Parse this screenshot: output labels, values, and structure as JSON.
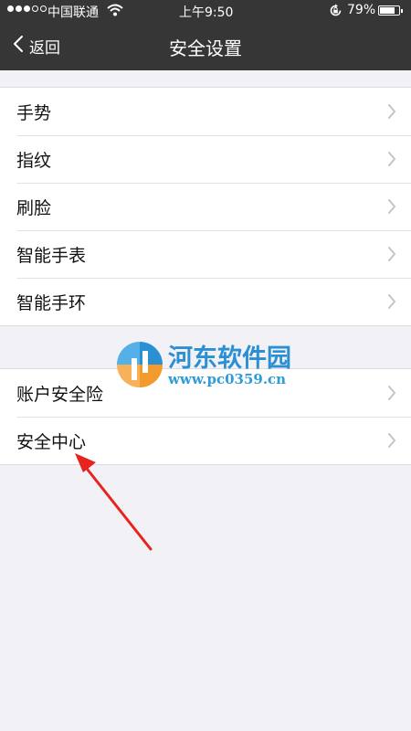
{
  "status_bar": {
    "carrier": "中国联通",
    "time": "上午9:50",
    "battery_percent": "79%",
    "battery_level": 0.79,
    "icons": [
      "signal-dots-icon",
      "wifi-icon",
      "rotation-lock-icon",
      "battery-icon"
    ]
  },
  "nav": {
    "back_label": "返回",
    "title": "安全设置"
  },
  "groups": [
    {
      "items": [
        {
          "label": "手势"
        },
        {
          "label": "指纹"
        },
        {
          "label": "刷脸"
        },
        {
          "label": "智能手表"
        },
        {
          "label": "智能手环"
        }
      ]
    },
    {
      "items": [
        {
          "label": "账户安全险"
        },
        {
          "label": "安全中心"
        }
      ]
    }
  ],
  "watermark": {
    "name": "河东软件园",
    "url": "www.pc0359.cn"
  },
  "colors": {
    "nav_background": "#363636",
    "page_background": "#f1f1f6",
    "annotation_arrow": "#e8231f",
    "watermark_blue": "#2b8fd3",
    "watermark_orange": "#f39a2d"
  }
}
